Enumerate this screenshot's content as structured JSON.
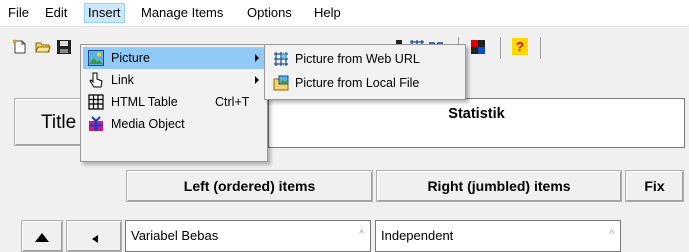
{
  "menubar": {
    "items": [
      "File",
      "Edit",
      "Insert",
      "Manage Items",
      "Options",
      "Help"
    ]
  },
  "insert_menu": {
    "items": [
      {
        "label": "Picture",
        "shortcut": ""
      },
      {
        "label": "Link",
        "shortcut": ""
      },
      {
        "label": "HTML Table",
        "shortcut": "Ctrl+T"
      },
      {
        "label": "Media Object",
        "shortcut": ""
      }
    ]
  },
  "picture_submenu": {
    "items": [
      "Picture from Web URL",
      "Picture from Local File"
    ]
  },
  "toolbar": {
    "help_glyph": "?"
  },
  "title_area": {
    "title_button_label": "Title",
    "title_value": "Statistik"
  },
  "columns": {
    "left_header": "Left (ordered) items",
    "right_header": "Right (jumbled) items",
    "fix_label": "Fix"
  },
  "rows": [
    {
      "left": "Variabel Bebas",
      "right": "Independent"
    }
  ],
  "colors": {
    "menu_highlight": "#91c9f7",
    "help_icon_bg": "#ffd800",
    "help_icon_fg": "#e00000"
  }
}
